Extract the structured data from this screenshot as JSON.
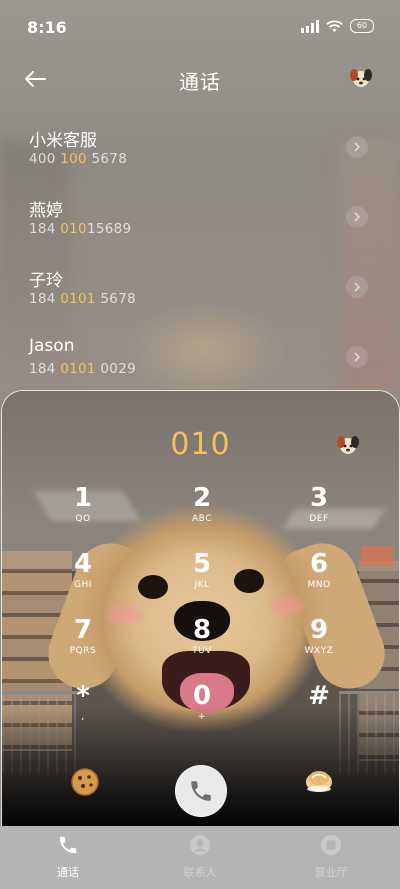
{
  "status_bar": {
    "time": "8:16",
    "battery": "60"
  },
  "header": {
    "title": "通话"
  },
  "contacts": [
    {
      "name": "小米客服",
      "number_parts": [
        {
          "text": "400 ",
          "hl": false
        },
        {
          "text": "100",
          "hl": true
        },
        {
          "text": " 5678",
          "hl": false
        }
      ]
    },
    {
      "name": "燕婷",
      "number_parts": [
        {
          "text": "184 ",
          "hl": false
        },
        {
          "text": "010",
          "hl": true
        },
        {
          "text": "15689",
          "hl": false
        }
      ]
    },
    {
      "name": "子玲",
      "number_parts": [
        {
          "text": "184 ",
          "hl": false
        },
        {
          "text": "0101",
          "hl": true
        },
        {
          "text": " 5678",
          "hl": false
        }
      ]
    },
    {
      "name": "Jason",
      "number_parts": [
        {
          "text": "184 ",
          "hl": false
        },
        {
          "text": "0101",
          "hl": true
        },
        {
          "text": " 0029",
          "hl": false
        }
      ]
    }
  ],
  "dialer": {
    "input": "010",
    "keys": [
      {
        "digit": "1",
        "letters": "QO"
      },
      {
        "digit": "2",
        "letters": "ABC"
      },
      {
        "digit": "3",
        "letters": "DEF"
      },
      {
        "digit": "4",
        "letters": "GHI"
      },
      {
        "digit": "5",
        "letters": "JKL"
      },
      {
        "digit": "6",
        "letters": "MNO"
      },
      {
        "digit": "7",
        "letters": "PQRS"
      },
      {
        "digit": "8",
        "letters": "TUV"
      },
      {
        "digit": "9",
        "letters": "WXYZ"
      },
      {
        "digit": "*",
        "letters": ","
      },
      {
        "digit": "0",
        "letters": "+"
      },
      {
        "digit": "#",
        "letters": ""
      }
    ]
  },
  "bottom_nav": [
    {
      "label": "通话",
      "icon": "phone-icon",
      "active": true
    },
    {
      "label": "联系人",
      "icon": "contacts-icon",
      "active": false
    },
    {
      "label": "营业厅",
      "icon": "service-hall-icon",
      "active": false
    }
  ],
  "colors": {
    "highlight": "#f3c25d",
    "nav_bg": "#b4b4b4"
  }
}
